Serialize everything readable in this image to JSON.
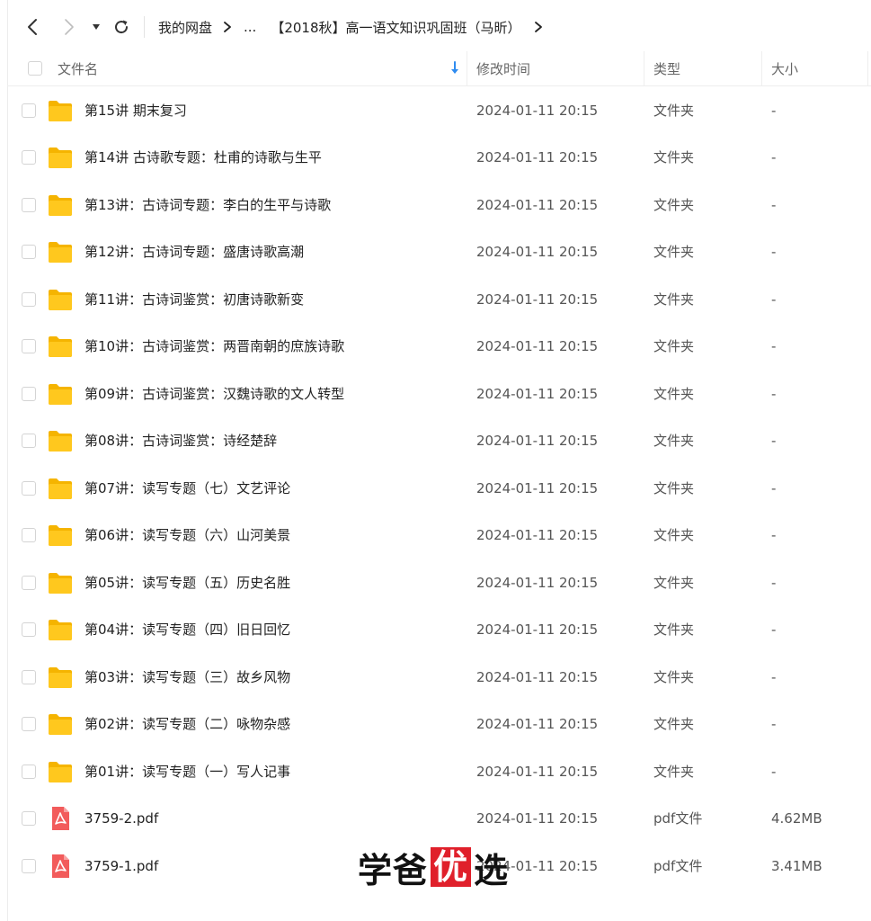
{
  "toolbar": {
    "back_icon": "chevron-left-icon",
    "forward_icon": "chevron-right-icon",
    "dropdown_icon": "caret-down-icon",
    "refresh_icon": "refresh-icon"
  },
  "breadcrumb": {
    "root": "我的网盘",
    "ellipsis": "...",
    "current": "【2018秋】高一语文知识巩固班（马昕）"
  },
  "header": {
    "name": "文件名",
    "mtime": "修改时间",
    "type": "类型",
    "size": "大小"
  },
  "files": [
    {
      "name": "第15讲 期末复习",
      "mtime": "2024-01-11 20:15",
      "type": "文件夹",
      "size": "-",
      "icon": "folder-icon"
    },
    {
      "name": "第14讲 古诗歌专题：杜甫的诗歌与生平",
      "mtime": "2024-01-11 20:15",
      "type": "文件夹",
      "size": "-",
      "icon": "folder-icon"
    },
    {
      "name": "第13讲：古诗词专题：李白的生平与诗歌",
      "mtime": "2024-01-11 20:15",
      "type": "文件夹",
      "size": "-",
      "icon": "folder-icon"
    },
    {
      "name": "第12讲：古诗词专题：盛唐诗歌高潮",
      "mtime": "2024-01-11 20:15",
      "type": "文件夹",
      "size": "-",
      "icon": "folder-icon"
    },
    {
      "name": "第11讲：古诗词鉴赏：初唐诗歌新变",
      "mtime": "2024-01-11 20:15",
      "type": "文件夹",
      "size": "-",
      "icon": "folder-icon"
    },
    {
      "name": "第10讲：古诗词鉴赏：两晋南朝的庶族诗歌",
      "mtime": "2024-01-11 20:15",
      "type": "文件夹",
      "size": "-",
      "icon": "folder-icon"
    },
    {
      "name": "第09讲：古诗词鉴赏：汉魏诗歌的文人转型",
      "mtime": "2024-01-11 20:15",
      "type": "文件夹",
      "size": "-",
      "icon": "folder-icon"
    },
    {
      "name": "第08讲：古诗词鉴赏：诗经楚辞",
      "mtime": "2024-01-11 20:15",
      "type": "文件夹",
      "size": "-",
      "icon": "folder-icon"
    },
    {
      "name": "第07讲：读写专题（七）文艺评论",
      "mtime": "2024-01-11 20:15",
      "type": "文件夹",
      "size": "-",
      "icon": "folder-icon"
    },
    {
      "name": "第06讲：读写专题（六）山河美景",
      "mtime": "2024-01-11 20:15",
      "type": "文件夹",
      "size": "-",
      "icon": "folder-icon"
    },
    {
      "name": "第05讲：读写专题（五）历史名胜",
      "mtime": "2024-01-11 20:15",
      "type": "文件夹",
      "size": "-",
      "icon": "folder-icon"
    },
    {
      "name": "第04讲：读写专题（四）旧日回忆",
      "mtime": "2024-01-11 20:15",
      "type": "文件夹",
      "size": "-",
      "icon": "folder-icon"
    },
    {
      "name": "第03讲：读写专题（三）故乡风物",
      "mtime": "2024-01-11 20:15",
      "type": "文件夹",
      "size": "-",
      "icon": "folder-icon"
    },
    {
      "name": "第02讲：读写专题（二）咏物杂感",
      "mtime": "2024-01-11 20:15",
      "type": "文件夹",
      "size": "-",
      "icon": "folder-icon"
    },
    {
      "name": "第01讲：读写专题（一）写人记事",
      "mtime": "2024-01-11 20:15",
      "type": "文件夹",
      "size": "-",
      "icon": "folder-icon"
    },
    {
      "name": "3759-2.pdf",
      "mtime": "2024-01-11 20:15",
      "type": "pdf文件",
      "size": "4.62MB",
      "icon": "pdf-icon"
    },
    {
      "name": "3759-1.pdf",
      "mtime": "2024-01-11 20:15",
      "type": "pdf文件",
      "size": "3.41MB",
      "icon": "pdf-icon"
    }
  ],
  "watermark": {
    "part1": "学爸",
    "part2": "优",
    "part3": "选"
  },
  "colors": {
    "folder": "#FFC81E",
    "folder_dark": "#F5B400",
    "pdf": "#F25B5B",
    "sort_arrow": "#2F8CF0",
    "watermark_box": "#E0202B"
  }
}
